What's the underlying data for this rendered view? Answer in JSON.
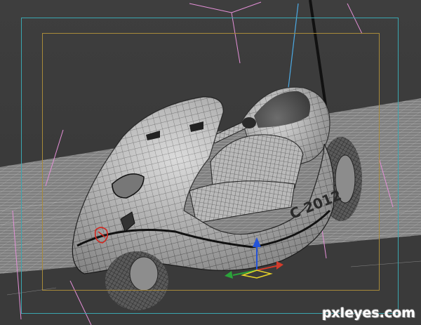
{
  "viewport": {
    "background": "#3b3b3b",
    "safe_frame_outer_color": "#3aa6b0",
    "safe_frame_inner_color": "#a88a3a",
    "grid_color": "#d8d8d8",
    "camera_line_color": "#e38fd6"
  },
  "model": {
    "decal_text": "C 2012",
    "body_color": "#c7c7c7",
    "wire_color": "#2a2a2a"
  },
  "gizmo": {
    "axis_x_color": "#d23c2c",
    "axis_y_color": "#2ba33a",
    "axis_z_color": "#2453d8",
    "plane_color": "#e8d42a"
  },
  "watermark": {
    "text": "pxleyes.com"
  }
}
